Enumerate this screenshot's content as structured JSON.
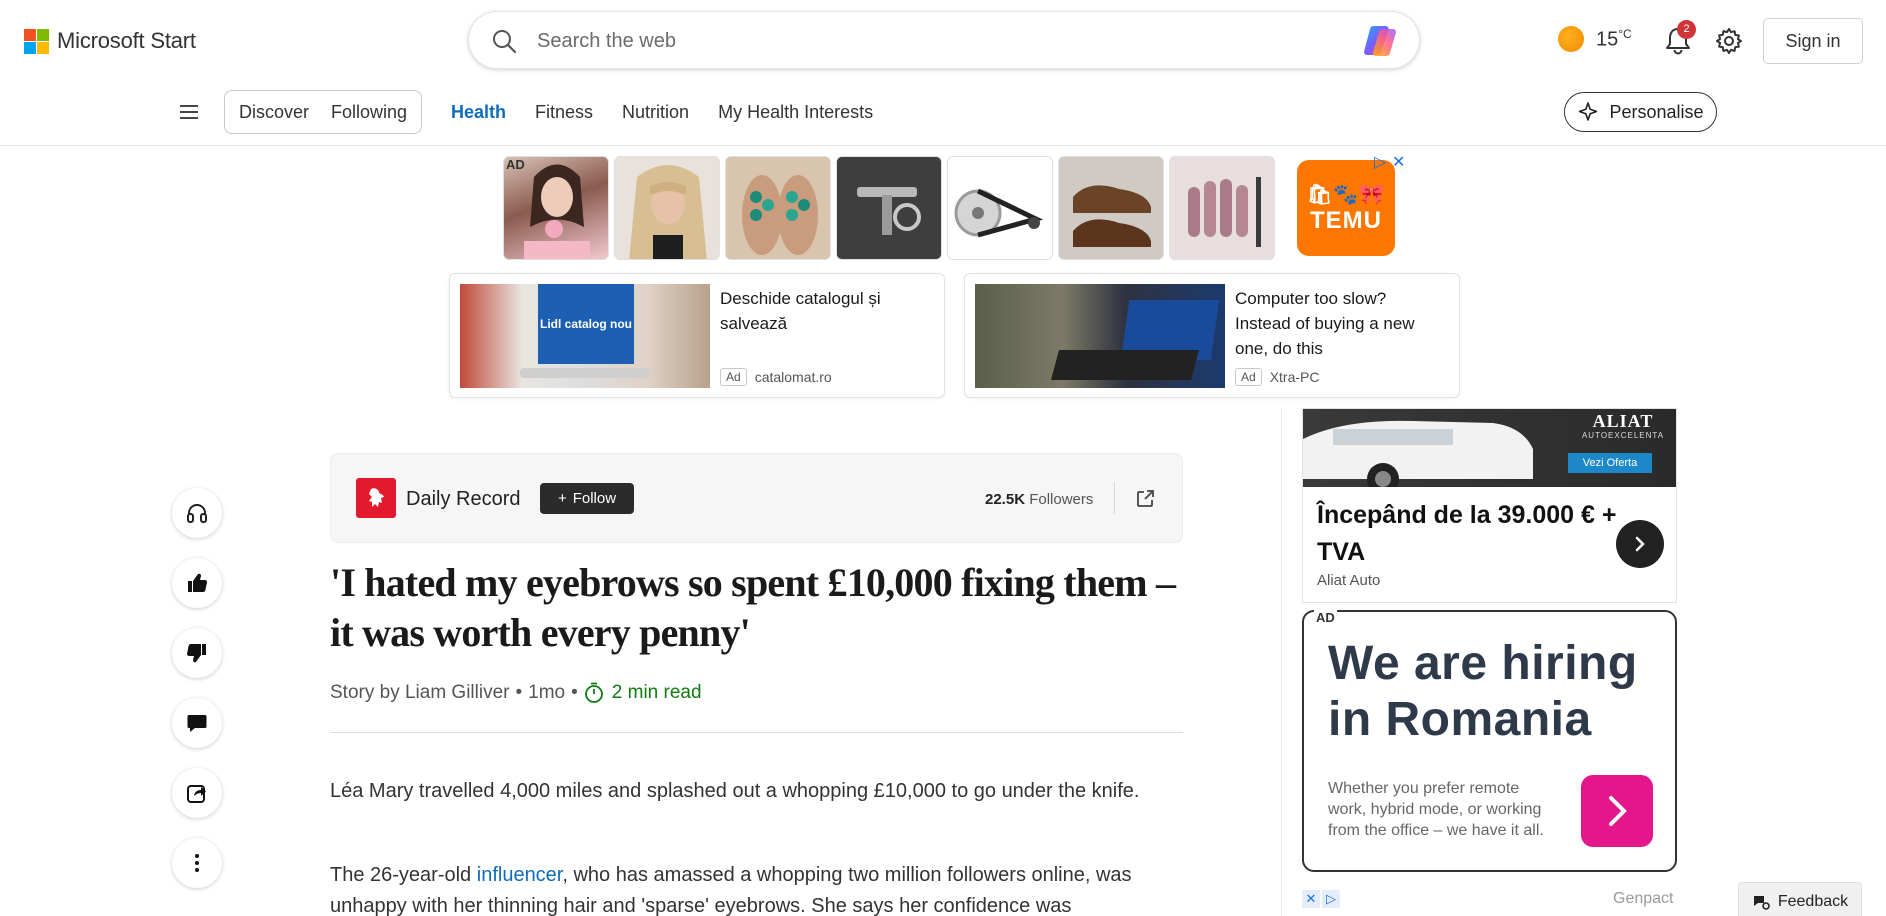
{
  "header": {
    "brand": "Microsoft Start",
    "search_placeholder": "Search the web",
    "weather_temp": "15",
    "weather_unit": "°C",
    "notifications_count": "2",
    "signin_label": "Sign in"
  },
  "nav": {
    "segments": [
      "Discover",
      "Following"
    ],
    "links": [
      {
        "label": "Health",
        "active": true
      },
      {
        "label": "Fitness",
        "active": false
      },
      {
        "label": "Nutrition",
        "active": false
      },
      {
        "label": "My Health Interests",
        "active": false
      }
    ],
    "personalise_label": "Personalise"
  },
  "ad_strip": {
    "ad_label": "AD",
    "thumb_names": [
      "choker-model",
      "blonde-wig",
      "sandals",
      "tool",
      "pulley-belt",
      "leather-shoes",
      "nails"
    ],
    "temu_top": "🛍🐾🎀",
    "temu_word": "TEMU"
  },
  "native_ads": [
    {
      "title": "Deschide catalogul și salvează",
      "badge": "Ad",
      "source": "catalomat.ro",
      "image_text": "Lidl catalog nou"
    },
    {
      "title": "Computer too slow? Instead of buying a new one, do this",
      "badge": "Ad",
      "source": "Xtra-PC"
    }
  ],
  "rail": {
    "buttons": [
      "headphones-icon",
      "thumbs-up-icon",
      "thumbs-down-icon",
      "comment-icon",
      "share-icon",
      "more-icon"
    ]
  },
  "article": {
    "source_name": "Daily Record",
    "follow_label": "Follow",
    "followers_count": "22.5K",
    "followers_label": "Followers",
    "headline": "'I hated my eyebrows so spent £10,000 fixing them – it was worth every penny'",
    "byline": "Story by Liam Gilliver",
    "age": "1mo",
    "read_time": "2 min read",
    "para1": "Léa Mary travelled 4,000 miles and splashed out a whopping £10,000 to go under the knife.",
    "para2_before": "The 26-year-old ",
    "para2_link": "influencer",
    "para2_after": ", who has amassed a whopping two million followers online, was unhappy with her thinning hair and 'sparse' eyebrows. She says her confidence was"
  },
  "right_ads": {
    "car_brand": "ALIAT",
    "car_brand_sub": "AUTOEXCELENTA",
    "car_cta": "Vezi Oferta",
    "car_title": "Începând de la 39.000 € + TVA",
    "car_source": "Aliat Auto",
    "hire_label": "AD",
    "hire_title": "We are hiring in Romania",
    "hire_text": "Whether you prefer remote work, hybrid mode, or working from the office – we have it all.",
    "hire_source": "Genpact"
  },
  "feedback_label": "Feedback",
  "colors": {
    "accent": "#0f6cbd",
    "read_time": "#107c10",
    "temu": "#fb7701",
    "daily_record": "#e3192e",
    "hire_button": "#e3168c"
  }
}
